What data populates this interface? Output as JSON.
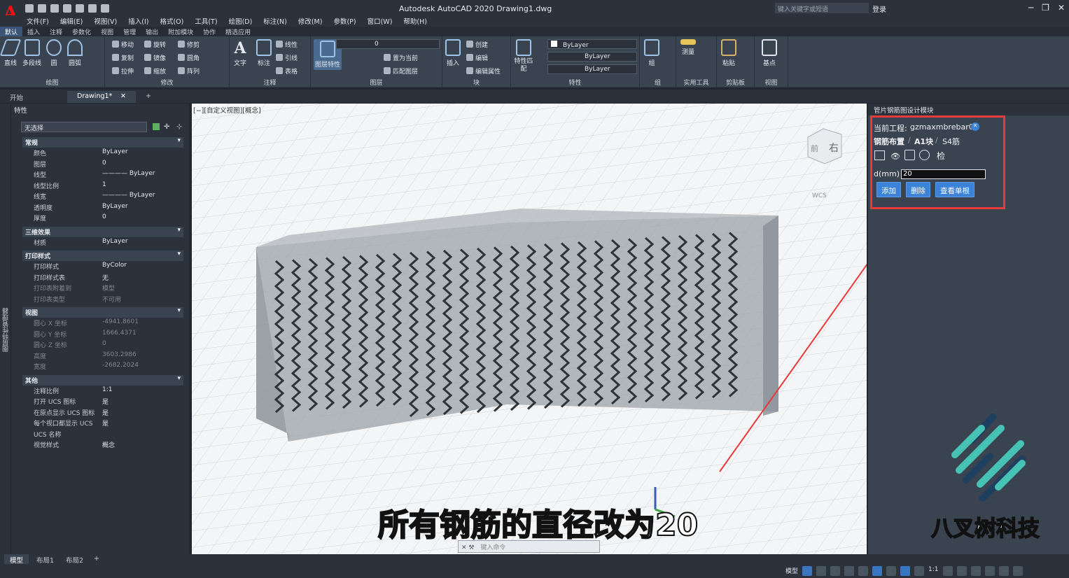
{
  "window": {
    "title": "Autodesk AutoCAD 2020    Drawing1.dwg",
    "search_placeholder": "键入关键字或短语",
    "login": "登录"
  },
  "menu": [
    "文件(F)",
    "编辑(E)",
    "视图(V)",
    "插入(I)",
    "格式(O)",
    "工具(T)",
    "绘图(D)",
    "标注(N)",
    "修改(M)",
    "参数(P)",
    "窗口(W)",
    "帮助(H)"
  ],
  "ribbon_tabs": [
    "默认",
    "插入",
    "注释",
    "参数化",
    "视图",
    "管理",
    "输出",
    "附加模块",
    "协作",
    "精选应用"
  ],
  "ribbon": {
    "draw": {
      "name": "绘图",
      "line": "直线",
      "polyline": "多段线",
      "circle": "圆",
      "arc": "圆弧"
    },
    "modify": {
      "name": "修改",
      "move": "移动",
      "rotate": "旋转",
      "trim": "修剪",
      "copy": "复制",
      "mirror": "镜像",
      "fillet": "圆角",
      "stretch": "拉伸",
      "scale": "缩放",
      "array": "阵列"
    },
    "annotation": {
      "name": "注释",
      "text": "文字",
      "dim": "标注",
      "linear": "线性",
      "leader": "引线",
      "table": "表格"
    },
    "layers": {
      "name": "图层",
      "props": "图层特性",
      "current": "置为当前",
      "match": "匹配图层",
      "layer_value": "0"
    },
    "block": {
      "name": "块",
      "insert": "插入",
      "create": "创建",
      "edit": "编辑",
      "edit_attr": "编辑属性"
    },
    "properties": {
      "name": "特性",
      "match": "特性匹配",
      "color": "ByLayer",
      "linetype": "ByLayer",
      "lineweight": "ByLayer"
    },
    "groups": {
      "name": "组",
      "group": "组"
    },
    "utilities": {
      "name": "实用工具",
      "measure": "测量"
    },
    "clipboard": {
      "name": "剪贴板",
      "paste": "粘贴"
    },
    "view": {
      "name": "视图",
      "base": "基点"
    }
  },
  "doc_tabs": [
    "开始",
    "Drawing1*"
  ],
  "properties_panel": {
    "title": "特性",
    "selection": "无选择",
    "side_label": "图层特性管理器",
    "sections": [
      {
        "name": "常规",
        "rows": [
          [
            "颜色",
            "ByLayer"
          ],
          [
            "图层",
            "0"
          ],
          [
            "线型",
            "———— ByLayer"
          ],
          [
            "线型比例",
            "1"
          ],
          [
            "线宽",
            "———— ByLayer"
          ],
          [
            "透明度",
            "ByLayer"
          ],
          [
            "厚度",
            "0"
          ]
        ]
      },
      {
        "name": "三维效果",
        "rows": [
          [
            "材质",
            "ByLayer"
          ]
        ]
      },
      {
        "name": "打印样式",
        "rows": [
          [
            "打印样式",
            "ByColor"
          ],
          [
            "打印样式表",
            "无"
          ],
          [
            "打印表附着到",
            "模型"
          ],
          [
            "打印表类型",
            "不可用"
          ]
        ]
      },
      {
        "name": "视图",
        "rows": [
          [
            "圆心 X 坐标",
            "-4941.8601"
          ],
          [
            "圆心 Y 坐标",
            "1666.4371"
          ],
          [
            "圆心 Z 坐标",
            "0"
          ],
          [
            "高度",
            "3603.2986"
          ],
          [
            "宽度",
            "-2682.2024"
          ]
        ]
      },
      {
        "name": "其他",
        "rows": [
          [
            "注释比例",
            "1:1"
          ],
          [
            "打开 UCS 图标",
            "是"
          ],
          [
            "在原点显示 UCS 图标",
            "是"
          ],
          [
            "每个视口都显示 UCS",
            "是"
          ],
          [
            "UCS 名称",
            ""
          ],
          [
            "视觉样式",
            "概念"
          ]
        ]
      }
    ]
  },
  "viewport": {
    "label": "[−][自定义视图][概念]",
    "viewcube_face": "右",
    "viewcube_front": "前",
    "wcs": "WCS"
  },
  "plugin": {
    "title": "管片钢筋图设计模块",
    "project_label": "当前工程:",
    "project_name": "gzmaxmbrebar01",
    "crumb1": "钢筋布置",
    "crumb2": "A1块",
    "crumb3": "S4筋",
    "check_label": "检",
    "d_label": "d(mm)",
    "d_value": "20",
    "add": "添加",
    "delete": "删除",
    "view_single": "查看单根"
  },
  "command_placeholder": "键入命令",
  "layout_tabs": [
    "模型",
    "布局1",
    "布局2"
  ],
  "status": {
    "model": "模型",
    "scale": "1:1"
  },
  "subtitle": "所有钢筋的直径改为20",
  "brand": "八叉树科技",
  "colors": {
    "accent_red": "#e83a3a",
    "button_blue": "#3b82d8",
    "brand_teal": "#46c3b4",
    "brand_navy": "#1e3f5e"
  }
}
